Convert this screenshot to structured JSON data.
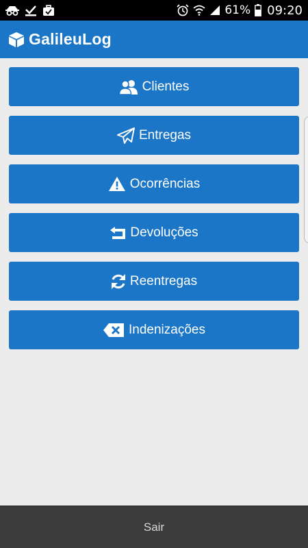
{
  "status_bar": {
    "left_icons": [
      "incognito-icon",
      "check-download-icon",
      "briefcase-icon"
    ],
    "right_icons": [
      "alarm-icon",
      "wifi-icon",
      "signal-icon",
      "battery-icon"
    ],
    "battery": "61%",
    "time": "09:20"
  },
  "app_bar": {
    "logo_icon": "cube-icon",
    "title": "GalileuLog"
  },
  "menu": {
    "items": [
      {
        "label": "Clientes",
        "icon": "users-icon"
      },
      {
        "label": "Entregas",
        "icon": "paper-plane-icon"
      },
      {
        "label": "Ocorrências",
        "icon": "warning-icon"
      },
      {
        "label": "Devoluções",
        "icon": "return-arrow-icon"
      },
      {
        "label": "Reentregas",
        "icon": "refresh-icon"
      },
      {
        "label": "Indenizações",
        "icon": "delete-x-icon"
      }
    ]
  },
  "footer": {
    "exit_label": "Sair"
  },
  "colors": {
    "primary": "#1b76c8",
    "background": "#ececec",
    "status_bar": "#000000",
    "bottom_bar": "#3b3b3b"
  }
}
